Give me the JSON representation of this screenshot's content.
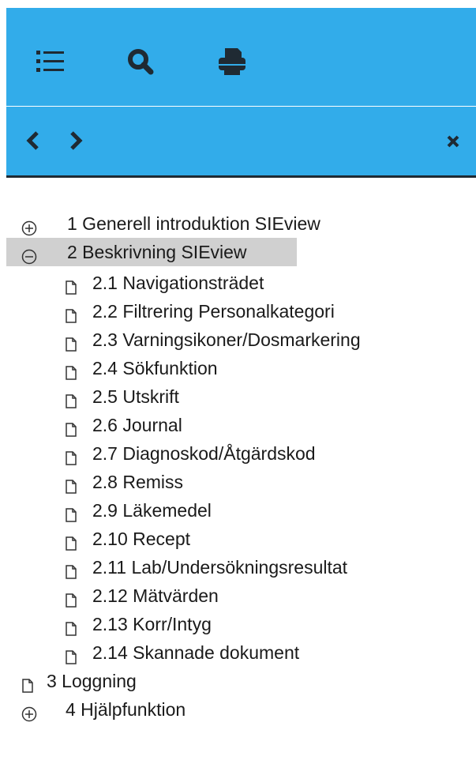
{
  "toolbar": {
    "icons": [
      "list-icon",
      "search-icon",
      "print-icon"
    ]
  },
  "navbar": {
    "icons": [
      "chevron-left-icon",
      "chevron-right-icon",
      "close-icon"
    ]
  },
  "colors": {
    "toolbar_bg": "#32acea",
    "icon": "#1f2a33",
    "selected_bg": "#d0d0d0"
  },
  "tree": [
    {
      "label": "1 Generell introduktion SIEview",
      "icon": "expand-icon",
      "selected": false
    },
    {
      "label": "2 Beskrivning SIEview",
      "icon": "collapse-icon",
      "selected": true
    },
    {
      "label": "2.1 Navigationsträdet",
      "icon": "document-icon"
    },
    {
      "label": "2.2 Filtrering Personalkategori",
      "icon": "document-icon"
    },
    {
      "label": "2.3 Varningsikoner/Dosmarkering",
      "icon": "document-icon"
    },
    {
      "label": "2.4 Sökfunktion",
      "icon": "document-icon"
    },
    {
      "label": "2.5 Utskrift",
      "icon": "document-icon"
    },
    {
      "label": "2.6 Journal",
      "icon": "document-icon"
    },
    {
      "label": "2.7 Diagnoskod/Åtgärdskod",
      "icon": "document-icon"
    },
    {
      "label": "2.8 Remiss",
      "icon": "document-icon"
    },
    {
      "label": "2.9 Läkemedel",
      "icon": "document-icon"
    },
    {
      "label": "2.10 Recept",
      "icon": "document-icon"
    },
    {
      "label": "2.11 Lab/Undersökningsresultat",
      "icon": "document-icon"
    },
    {
      "label": "2.12 Mätvärden",
      "icon": "document-icon"
    },
    {
      "label": "2.13 Korr/Intyg",
      "icon": "document-icon"
    },
    {
      "label": "2.14 Skannade dokument",
      "icon": "document-icon"
    },
    {
      "label": "3 Loggning",
      "icon": "document-icon"
    },
    {
      "label": "4 Hjälpfunktion",
      "icon": "expand-icon"
    }
  ]
}
